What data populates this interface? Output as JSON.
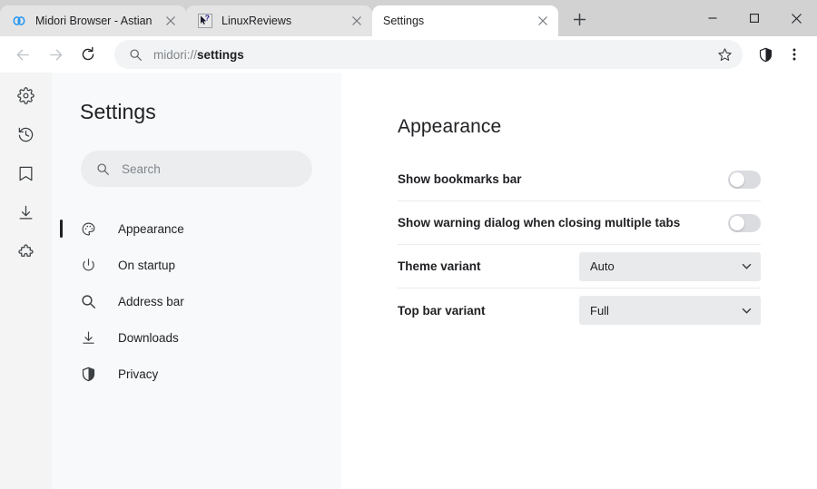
{
  "window": {
    "controls": [
      {
        "name": "minimize-button",
        "glyph": "minimize-icon"
      },
      {
        "name": "maximize-button",
        "glyph": "maximize-icon"
      },
      {
        "name": "close-button",
        "glyph": "close-icon"
      }
    ]
  },
  "tabs": [
    {
      "title": "Midori Browser - Astian",
      "favicon": "midori-logo-icon",
      "active": false
    },
    {
      "title": "LinuxReviews",
      "favicon": "cursor-question-icon",
      "active": false
    },
    {
      "title": "Settings",
      "favicon": "none",
      "active": true
    }
  ],
  "new_tab_label": "+",
  "toolbar": {
    "back_icon": "arrow-left-icon",
    "forward_icon": "arrow-right-icon",
    "reload_icon": "reload-icon",
    "url_scheme": "midori://",
    "url_host": "settings",
    "url_full": "midori://settings",
    "bookmark_icon": "star-icon",
    "shield_icon": "shield-icon",
    "menu_icon": "more-vertical-icon"
  },
  "browser_sidebar": {
    "items": [
      {
        "label": "Settings",
        "icon": "gear-icon",
        "active": true
      },
      {
        "label": "History",
        "icon": "history-clock-icon",
        "active": false
      },
      {
        "label": "Bookmarks",
        "icon": "bookmark-icon",
        "active": false
      },
      {
        "label": "Downloads",
        "icon": "download-icon",
        "active": false
      },
      {
        "label": "Extensions",
        "icon": "puzzle-icon",
        "active": false
      }
    ]
  },
  "settings_panel": {
    "title": "Settings",
    "search": {
      "placeholder": "Search",
      "value": "",
      "icon": "search-icon"
    },
    "nav": [
      {
        "label": "Appearance",
        "icon": "palette-icon",
        "active": true
      },
      {
        "label": "On startup",
        "icon": "power-icon",
        "active": false
      },
      {
        "label": "Address bar",
        "icon": "search-icon",
        "active": false
      },
      {
        "label": "Downloads",
        "icon": "download-icon",
        "active": false
      },
      {
        "label": "Privacy",
        "icon": "shield-icon",
        "active": false
      }
    ]
  },
  "content": {
    "heading": "Appearance",
    "rows": [
      {
        "label": "Show bookmarks bar",
        "type": "toggle",
        "value": "off"
      },
      {
        "label": "Show warning dialog when closing multiple tabs",
        "type": "toggle",
        "value": "off"
      },
      {
        "label": "Theme variant",
        "type": "select",
        "value": "Auto"
      },
      {
        "label": "Top bar variant",
        "type": "select",
        "value": "Full"
      }
    ]
  },
  "colors": {
    "tabstrip_bg": "#d2d2d2",
    "active_tab_bg": "#ffffff",
    "panel_bg": "#f8f9fa",
    "urlbar_bg": "#f1f3f4",
    "toggle_off": "#dadce0",
    "select_bg": "#e9eaec",
    "accent": "#1a73e8",
    "text": "#202124"
  }
}
